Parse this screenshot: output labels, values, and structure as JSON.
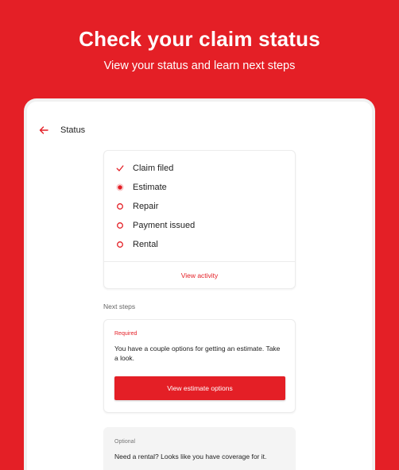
{
  "promo": {
    "title": "Check your claim status",
    "subtitle": "View your status and learn next steps"
  },
  "app_bar": {
    "back_icon": "arrow-left-icon",
    "title": "Status"
  },
  "status_card": {
    "items": [
      {
        "label": "Claim filed",
        "state": "complete",
        "icon": "check-icon"
      },
      {
        "label": "Estimate",
        "state": "current",
        "icon": "filled-dot-icon"
      },
      {
        "label": "Repair",
        "state": "pending",
        "icon": "empty-circle-icon"
      },
      {
        "label": "Payment issued",
        "state": "pending",
        "icon": "empty-circle-icon"
      },
      {
        "label": "Rental",
        "state": "pending",
        "icon": "empty-circle-icon"
      }
    ],
    "view_activity_label": "View activity"
  },
  "next_steps": {
    "section_label": "Next steps",
    "required_card": {
      "badge": "Required",
      "text": "You have a couple options for getting an estimate. Take a look.",
      "button_label": "View estimate options"
    },
    "optional_card": {
      "badge": "Optional",
      "text": "Need a rental? Looks like you have coverage for it."
    }
  },
  "colors": {
    "brand_red": "#e41f26",
    "text_dark": "#222222",
    "card_border": "#ececec",
    "optional_bg": "#f4f4f4"
  }
}
